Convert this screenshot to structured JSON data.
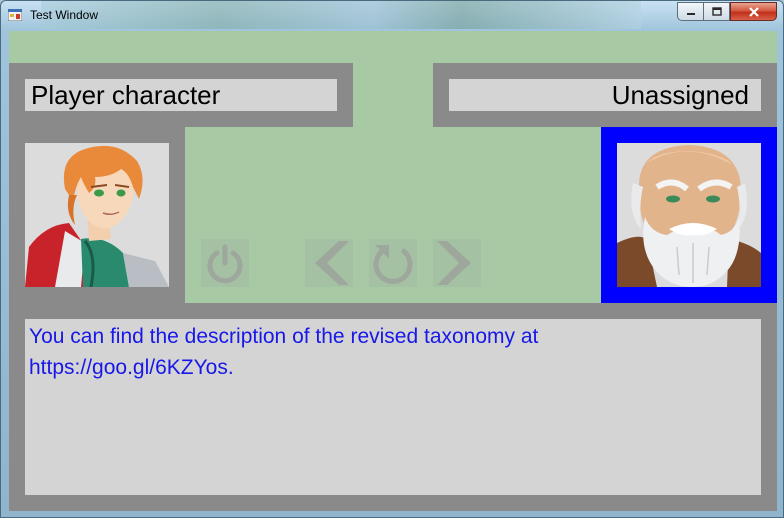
{
  "window": {
    "title": "Test Window",
    "controls": {
      "minimize": "minimize",
      "maximize": "maximize",
      "close": "close"
    }
  },
  "players": {
    "left": {
      "name": "Player character",
      "portrait": "young-orange-haired-hero-portrait"
    },
    "right": {
      "name": "Unassigned",
      "portrait": "bald-white-bearded-elder-portrait",
      "highlight_color": "#0000ff"
    }
  },
  "controls": {
    "power": "power-icon",
    "previous": "chevron-left-icon",
    "refresh": "refresh-icon",
    "next": "chevron-right-icon"
  },
  "description": {
    "lines": [
      "You can find the description of the revised taxonomy at",
      "https://goo.gl/6KZYos."
    ],
    "text_color": "#1818e8"
  },
  "colors": {
    "background_green": "#a7c9a4",
    "panel_gray": "#8a8a8a",
    "box_gray": "#d4d4d4"
  }
}
